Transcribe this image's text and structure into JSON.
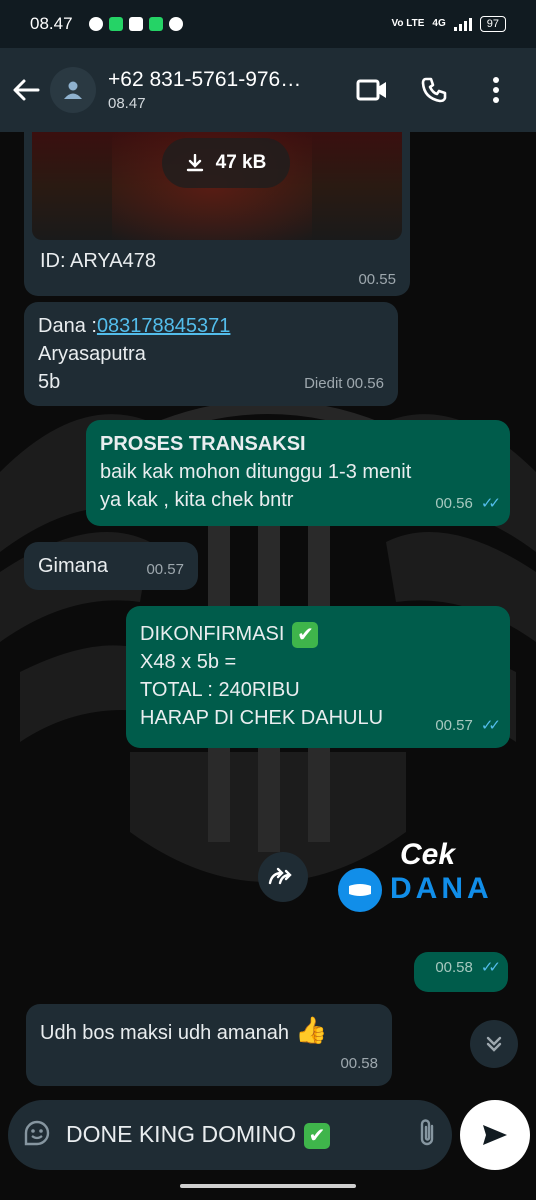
{
  "status_bar": {
    "time": "08.47",
    "network": "4G",
    "volte": "Vo LTE",
    "battery": "97"
  },
  "header": {
    "contact_name": "+62 831-5761-976…",
    "contact_status": "08.47"
  },
  "messages": {
    "image": {
      "size": "47 kB",
      "caption": "ID: ARYA478",
      "time": "00.55"
    },
    "dana": {
      "prefix": "Dana :",
      "number": "083178845371",
      "line2": "Aryasaputra",
      "line3": "5b",
      "edited": "Diedit",
      "time": "00.56"
    },
    "proses": {
      "title": "PROSES TRANSAKSI",
      "line1": "baik kak mohon ditunggu 1-3 menit",
      "line2": "ya kak , kita chek bntr",
      "time": "00.56"
    },
    "gimana": {
      "text": "Gimana",
      "time": "00.57"
    },
    "konfirmasi": {
      "line1": "DIKONFIRMASI",
      "line2": "X48 x 5b =",
      "line3": "TOTAL : 240RIBU",
      "line4": "HARAP DI CHEK DAHULU",
      "time": "00.57"
    },
    "sticker": {
      "cek": "Cek",
      "dana": "DANA",
      "time": "00.58"
    },
    "udh": {
      "text": "Udh bos maksi udh amanah",
      "time": "00.58"
    }
  },
  "composer": {
    "value": "DONE KING DOMINO"
  },
  "icons": {
    "back": "arrow-left-icon",
    "avatar": "person-icon",
    "video": "video-call-icon",
    "call": "phone-icon",
    "menu": "more-vert-icon",
    "download": "download-icon",
    "forward": "forward-icon",
    "scroll": "double-chevron-down-icon",
    "emoji": "sticker-icon",
    "attach": "paperclip-icon",
    "send": "send-icon"
  },
  "colors": {
    "incoming": "#1f2c34",
    "outgoing": "#005c4b",
    "tick": "#53bdeb",
    "dana": "#118ee9"
  }
}
